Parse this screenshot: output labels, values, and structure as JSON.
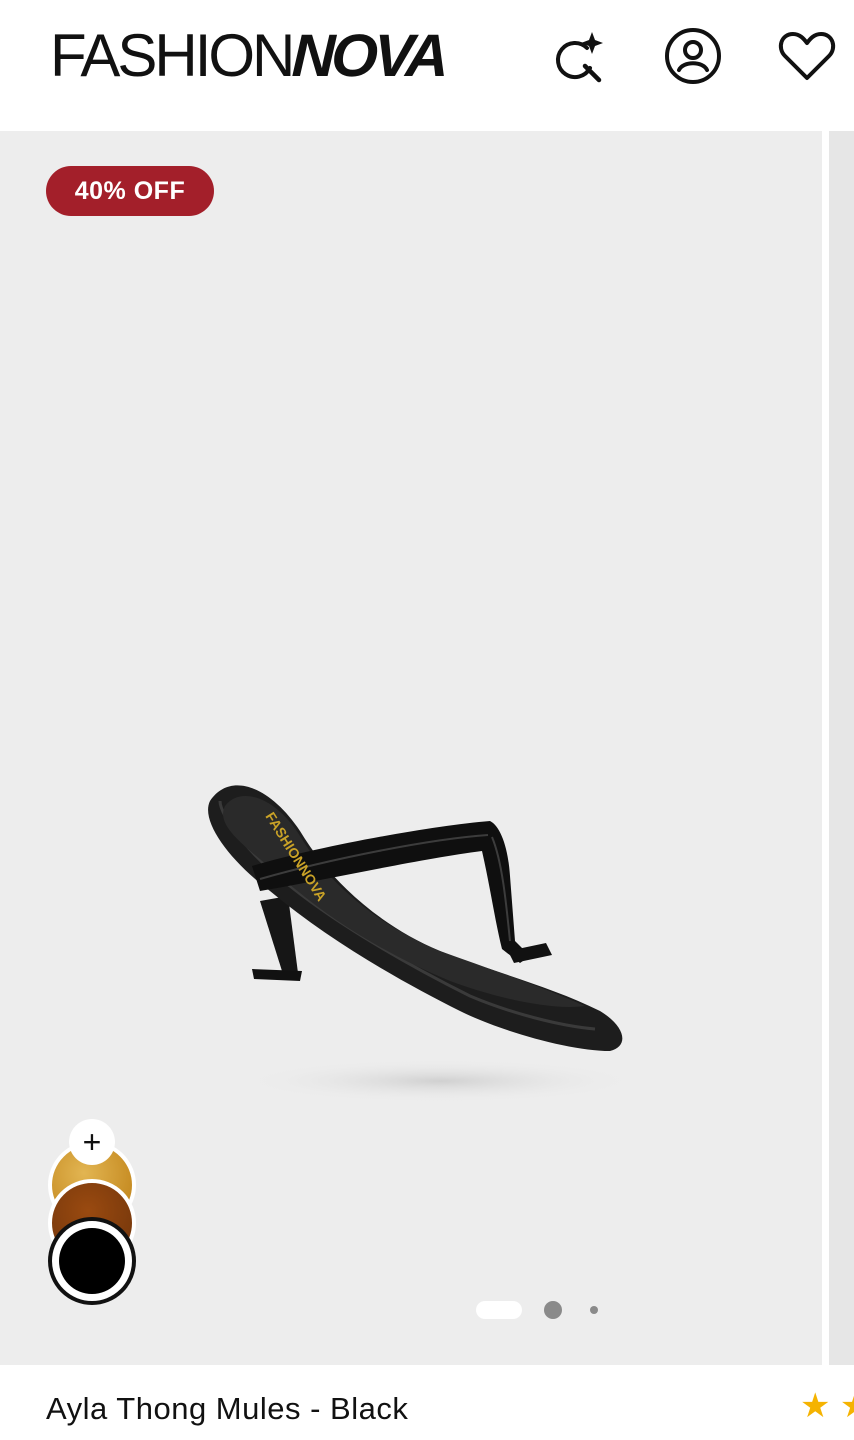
{
  "header": {
    "logo_part1": "FASHION",
    "logo_part2": "NOVA"
  },
  "icons": {
    "search": "ai-search-sparkle-icon",
    "account": "account-icon",
    "wishlist": "heart-icon"
  },
  "product": {
    "badge": "40% OFF",
    "title": "Ayla Thong Mules - Black",
    "insole_brand": "FASHIONNOVA",
    "rating_stars": "★ ★",
    "colors": {
      "badge": "#a31f2a",
      "star": "#f5b301"
    }
  },
  "swatches": {
    "more_label": "+",
    "items": [
      {
        "name": "Gold",
        "color": "#d4a040"
      },
      {
        "name": "Brown",
        "color": "#7b3a0c"
      },
      {
        "name": "Black",
        "color": "#000000",
        "selected": true
      }
    ]
  },
  "gallery": {
    "total_dots": 3,
    "active_index": 1
  }
}
